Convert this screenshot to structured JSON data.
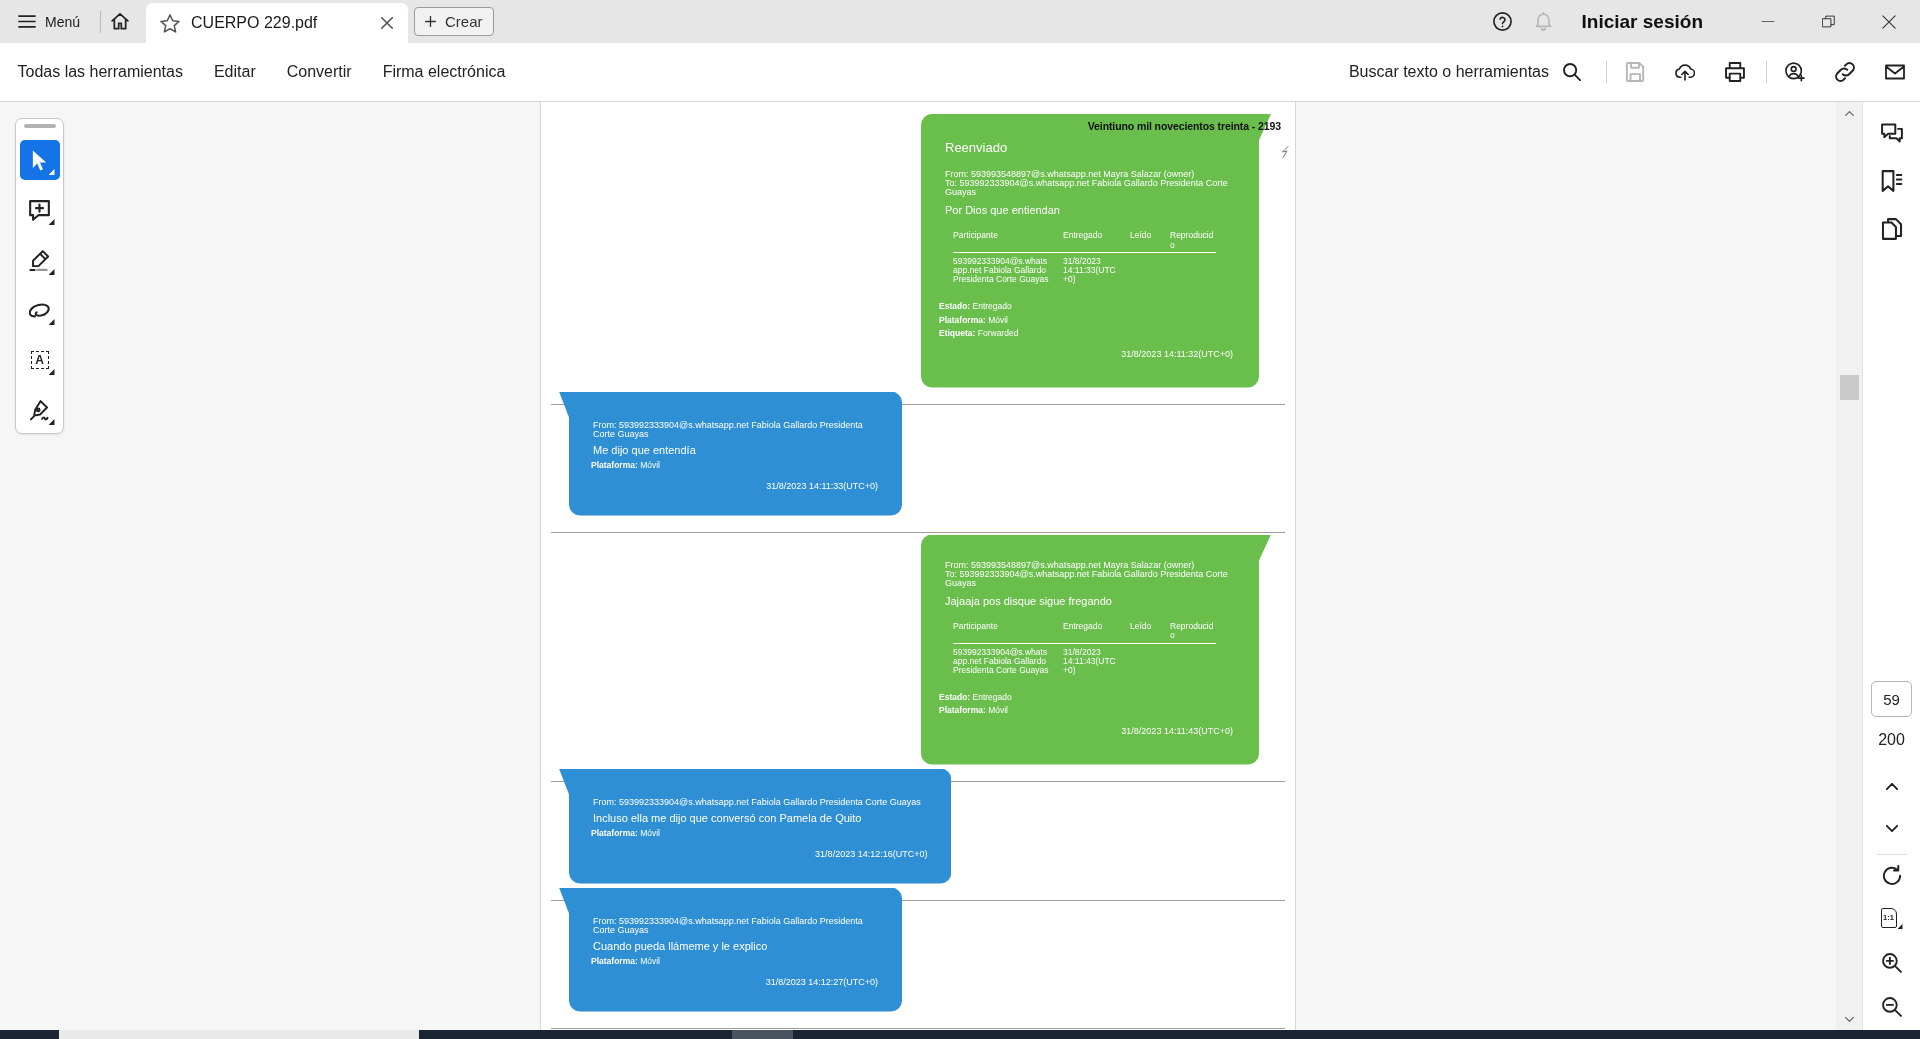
{
  "title_bar": {
    "menu_label": "Menú",
    "tabs": [
      {
        "title": "CUERPO 229.pdf",
        "selected": true
      }
    ],
    "create_label": "Crear",
    "actions": [
      {
        "kind": "help",
        "disabled": false
      },
      {
        "kind": "notifications",
        "disabled": true
      }
    ],
    "sign_in": "Iniciar sesión"
  },
  "toolbar": {
    "menus": [
      "Todas las herramientas",
      "Editar",
      "Convertir",
      "Firma electrónica"
    ],
    "search_label": "Buscar texto o herramientas",
    "action_groups": [
      [
        {
          "kind": "save",
          "disabled": true
        },
        {
          "kind": "upload",
          "disabled": false
        },
        {
          "kind": "print",
          "disabled": false
        }
      ],
      [
        {
          "kind": "share",
          "disabled": false
        },
        {
          "kind": "link",
          "disabled": false
        },
        {
          "kind": "email",
          "disabled": false
        }
      ]
    ]
  },
  "tools": [
    {
      "kind": "select",
      "selected": true
    },
    {
      "kind": "comment",
      "selected": false
    },
    {
      "kind": "highlight",
      "selected": false
    },
    {
      "kind": "draw",
      "selected": false
    },
    {
      "kind": "text",
      "glyph": "A",
      "selected": false
    },
    {
      "kind": "sign",
      "selected": false
    }
  ],
  "document": {
    "stamp": "Veintiuno mil novecientos treinta - 2193",
    "messages": [
      {
        "kind": "outgoing",
        "forwarded_label": "Reenviado",
        "from": "From: 593993548897@s.whatsapp.net Mayra Salazar (owner)",
        "to": "To: 593992333904@s.whatsapp.net Fabiola Gallardo Presidenta Corte Guayas",
        "text": "Por Dios que entiendan",
        "receipts": {
          "columns": [
            "Participante",
            "Entregado",
            "Leído",
            "Reproducido"
          ],
          "rows": [
            {
              "participant": "593992333904@s.whatsapp.net Fabiola Gallardo Presidenta Corte Guayas",
              "delivered": "31/8/2023 14:11:33(UTC+0)"
            }
          ]
        },
        "details": [
          "**Estado:** Entregado",
          "**Plataforma:** Móvil",
          "**Etiqueta:** Forwarded"
        ],
        "time": "31/8/2023 14:11:32(UTC+0)"
      },
      {
        "kind": "incoming",
        "from": "From: 593992333904@s.whatsapp.net Fabiola Gallardo Presidenta Corte Guayas",
        "text": "Me dijo que entendía",
        "details": [
          "**Plataforma:** Móvil"
        ],
        "time": "31/8/2023 14:11:33(UTC+0)"
      },
      {
        "kind": "outgoing",
        "from": "From: 593993548897@s.whatsapp.net Mayra Salazar (owner)",
        "to": "To: 593992333904@s.whatsapp.net Fabiola Gallardo Presidenta Corte Guayas",
        "text": "Jajaaja pos disque sigue fregando",
        "receipts": {
          "columns": [
            "Participante",
            "Entregado",
            "Leído",
            "Reproducido"
          ],
          "rows": [
            {
              "participant": "593992333904@s.whatsapp.net Fabiola Gallardo Presidenta Corte Guayas",
              "delivered": "31/8/2023 14:11:43(UTC+0)"
            }
          ]
        },
        "details": [
          "**Estado:** Entregado",
          "**Plataforma:** Móvil"
        ],
        "time": "31/8/2023 14:11:43(UTC+0)"
      },
      {
        "kind": "incoming",
        "from": "From: 593992333904@s.whatsapp.net Fabiola Gallardo Presidenta Corte Guayas",
        "text": "Incluso ella me dijo que conversó con Pamela de Quito",
        "details": [
          "**Plataforma:** Móvil"
        ],
        "time": "31/8/2023 14:12:16(UTC+0)"
      },
      {
        "kind": "incoming",
        "from": "From: 593992333904@s.whatsapp.net Fabiola Gallardo Presidenta Corte Guayas",
        "text": "Cuando pueda llámeme y le explico",
        "details": [
          "**Plataforma:** Móvil"
        ],
        "time": "31/8/2023 14:12:27(UTC+0)"
      }
    ]
  },
  "page_nav": {
    "current": "59",
    "total": "200",
    "fit_label": "1:1"
  }
}
